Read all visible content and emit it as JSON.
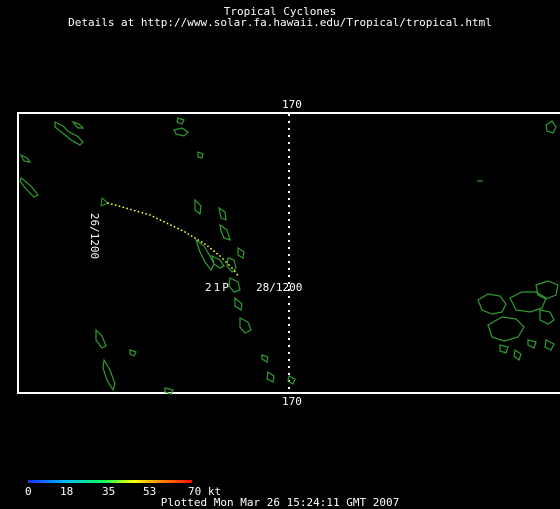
{
  "header": {
    "title": "Tropical Cyclones",
    "subtitle": "Details at http://www.solar.fa.hawaii.edu/Tropical/tropical.html"
  },
  "map": {
    "meridian_label_top": "170",
    "meridian_label_bottom": "170",
    "storm_label": "21P",
    "track_start_label": "26/1200",
    "track_end_label": "28/1200",
    "colors": {
      "frame": "#ffffff",
      "coast": "#2e9d2e",
      "track": "#ffff33",
      "background": "#000000"
    }
  },
  "legend": {
    "ticks": [
      "0",
      "18",
      "35",
      "53",
      "70 kt"
    ],
    "colors": [
      "#1a2cff",
      "#00b8ff",
      "#00ff60",
      "#ffff00",
      "#ff8000",
      "#ff1000"
    ]
  },
  "footer": {
    "plotted": "Plotted Mon Mar 26 15:24:11 GMT 2007"
  }
}
